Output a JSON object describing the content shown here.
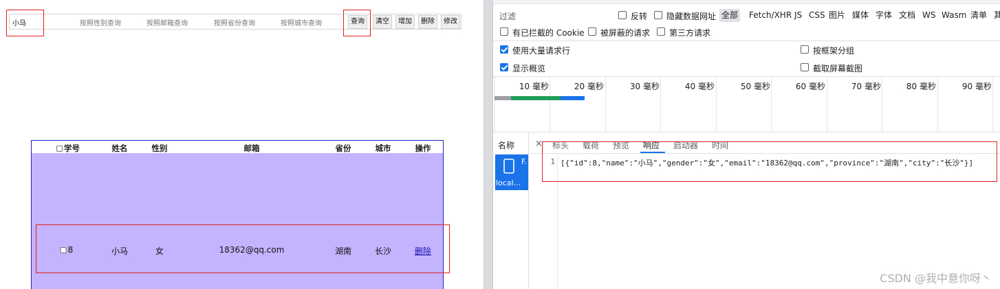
{
  "search": {
    "name_value": "小马",
    "gender_placeholder": "按照性别查询",
    "email_placeholder": "按照邮箱查询",
    "province_placeholder": "按照省份查询",
    "city_placeholder": "按照城市查询",
    "query_label": "查询",
    "clear_label": "清空",
    "add_label": "增加",
    "delete_label": "删除",
    "edit_label": "修改"
  },
  "table": {
    "headers": [
      "学号",
      "姓名",
      "性别",
      "邮箱",
      "省份",
      "城市",
      "操作"
    ],
    "rows": [
      {
        "id": "8",
        "name": "小马",
        "gender": "女",
        "email": "18362@qq.com",
        "province": "湖南",
        "city": "长沙",
        "action": "删除"
      }
    ]
  },
  "devtools": {
    "filter_label": "过滤",
    "invert_label": "反转",
    "hide_data_urls_label": "隐藏数据网址",
    "type_filters": [
      "全部",
      "Fetch/XHR",
      "JS",
      "CSS",
      "图片",
      "媒体",
      "字体",
      "文档",
      "WS",
      "Wasm",
      "清单",
      "其"
    ],
    "blocked_cookies_label": "有已拦截的 Cookie",
    "blocked_requests_label": "被屏蔽的请求",
    "third_party_label": "第三方请求",
    "large_rows_label": "使用大量请求行",
    "group_by_frame_label": "按框架分组",
    "show_overview_label": "显示概览",
    "capture_screenshots_label": "截取屏幕截图",
    "timeline_ticks": [
      "10 毫秒",
      "20 毫秒",
      "30 毫秒",
      "40 毫秒",
      "50 毫秒",
      "60 毫秒",
      "70 毫秒",
      "80 毫秒",
      "90 毫秒"
    ],
    "name_header": "名称",
    "request_name_short": "F.",
    "request_host": "local...",
    "detail_tabs": [
      "标头",
      "载荷",
      "预览",
      "响应",
      "启动器",
      "时间"
    ],
    "active_tab": "响应",
    "line_number": "1",
    "response_body": "[{\"id\":8,\"name\":\"小马\",\"gender\":\"女\",\"email\":\"18362@qq.com\",\"province\":\"湖南\",\"city\":\"长沙\"}]",
    "colors": {
      "accent": "#1a73e8",
      "highlight": "#e02020",
      "table_bg": "#c4b4ff"
    }
  },
  "watermark": "CSDN @我中意你呀丶"
}
